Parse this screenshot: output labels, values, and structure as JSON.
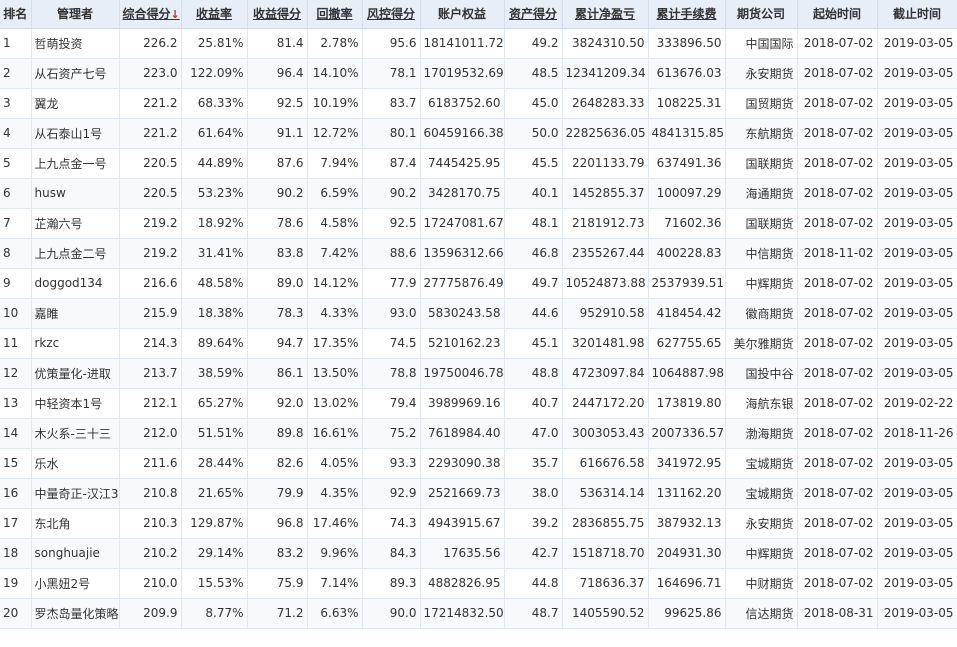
{
  "columns": [
    {
      "key": "rank",
      "label": "排名",
      "sortable": false,
      "align": "left"
    },
    {
      "key": "manager",
      "label": "管理者",
      "sortable": false,
      "align": "left"
    },
    {
      "key": "composite",
      "label": "综合得分",
      "sortable": true,
      "active": true,
      "arrow": "↓",
      "align": "right"
    },
    {
      "key": "return_rate",
      "label": "收益率",
      "sortable": true,
      "align": "right"
    },
    {
      "key": "return_score",
      "label": "收益得分",
      "sortable": true,
      "align": "right"
    },
    {
      "key": "drawdown",
      "label": "回撤率",
      "sortable": true,
      "align": "right"
    },
    {
      "key": "risk_score",
      "label": "风控得分",
      "sortable": true,
      "align": "right"
    },
    {
      "key": "equity",
      "label": "账户权益",
      "sortable": false,
      "align": "right"
    },
    {
      "key": "asset_score",
      "label": "资产得分",
      "sortable": true,
      "align": "right"
    },
    {
      "key": "net_pnl",
      "label": "累计净盈亏",
      "sortable": true,
      "align": "right"
    },
    {
      "key": "fees",
      "label": "累计手续费",
      "sortable": true,
      "align": "right"
    },
    {
      "key": "company",
      "label": "期货公司",
      "sortable": false,
      "align": "right"
    },
    {
      "key": "start",
      "label": "起始时间",
      "sortable": false,
      "align": "right"
    },
    {
      "key": "end",
      "label": "截止时间",
      "sortable": false,
      "align": "right"
    }
  ],
  "colors": {
    "link": "#1a4fd6",
    "profit": "#e02020",
    "header_bg": "#e6eef8"
  },
  "rows": [
    {
      "rank": "1",
      "manager": "哲萌投资",
      "composite": "226.2",
      "return_rate": "25.81%",
      "return_score": "81.4",
      "drawdown": "2.78%",
      "risk_score": "95.6",
      "equity": "18141011.72",
      "asset_score": "49.2",
      "net_pnl": "3824310.50",
      "fees": "333896.50",
      "company": "中国国际",
      "start": "2018-07-02",
      "end": "2019-03-05"
    },
    {
      "rank": "2",
      "manager": "从石资产七号",
      "composite": "223.0",
      "return_rate": "122.09%",
      "return_score": "96.4",
      "drawdown": "14.10%",
      "risk_score": "78.1",
      "equity": "17019532.69",
      "asset_score": "48.5",
      "net_pnl": "12341209.34",
      "fees": "613676.03",
      "company": "永安期货",
      "start": "2018-07-02",
      "end": "2019-03-05"
    },
    {
      "rank": "3",
      "manager": "翼龙",
      "composite": "221.2",
      "return_rate": "68.33%",
      "return_score": "92.5",
      "drawdown": "10.19%",
      "risk_score": "83.7",
      "equity": "6183752.60",
      "asset_score": "45.0",
      "net_pnl": "2648283.33",
      "fees": "108225.31",
      "company": "国贸期货",
      "start": "2018-07-02",
      "end": "2019-03-05"
    },
    {
      "rank": "4",
      "manager": "从石泰山1号",
      "composite": "221.2",
      "return_rate": "61.64%",
      "return_score": "91.1",
      "drawdown": "12.72%",
      "risk_score": "80.1",
      "equity": "60459166.38",
      "asset_score": "50.0",
      "net_pnl": "22825636.05",
      "fees": "4841315.85",
      "company": "东航期货",
      "start": "2018-07-02",
      "end": "2019-03-05"
    },
    {
      "rank": "5",
      "manager": "上九点金一号",
      "composite": "220.5",
      "return_rate": "44.89%",
      "return_score": "87.6",
      "drawdown": "7.94%",
      "risk_score": "87.4",
      "equity": "7445425.95",
      "asset_score": "45.5",
      "net_pnl": "2201133.79",
      "fees": "637491.36",
      "company": "国联期货",
      "start": "2018-07-02",
      "end": "2019-03-05"
    },
    {
      "rank": "6",
      "manager": "husw",
      "composite": "220.5",
      "return_rate": "53.23%",
      "return_score": "90.2",
      "drawdown": "6.59%",
      "risk_score": "90.2",
      "equity": "3428170.75",
      "asset_score": "40.1",
      "net_pnl": "1452855.37",
      "fees": "100097.29",
      "company": "海通期货",
      "start": "2018-07-02",
      "end": "2019-03-05"
    },
    {
      "rank": "7",
      "manager": "芷瀚六号",
      "composite": "219.2",
      "return_rate": "18.92%",
      "return_score": "78.6",
      "drawdown": "4.58%",
      "risk_score": "92.5",
      "equity": "17247081.67",
      "asset_score": "48.1",
      "net_pnl": "2181912.73",
      "fees": "71602.36",
      "company": "国联期货",
      "start": "2018-07-02",
      "end": "2019-03-05"
    },
    {
      "rank": "8",
      "manager": "上九点金二号",
      "composite": "219.2",
      "return_rate": "31.41%",
      "return_score": "83.8",
      "drawdown": "7.42%",
      "risk_score": "88.6",
      "equity": "13596312.66",
      "asset_score": "46.8",
      "net_pnl": "2355267.44",
      "fees": "400228.83",
      "company": "中信期货",
      "start": "2018-11-02",
      "end": "2019-03-05"
    },
    {
      "rank": "9",
      "manager": "doggod134",
      "composite": "216.6",
      "return_rate": "48.58%",
      "return_score": "89.0",
      "drawdown": "14.12%",
      "risk_score": "77.9",
      "equity": "27775876.49",
      "asset_score": "49.7",
      "net_pnl": "10524873.88",
      "fees": "2537939.51",
      "company": "中辉期货",
      "start": "2018-07-02",
      "end": "2019-03-05"
    },
    {
      "rank": "10",
      "manager": "嘉睢",
      "composite": "215.9",
      "return_rate": "18.38%",
      "return_score": "78.3",
      "drawdown": "4.33%",
      "risk_score": "93.0",
      "equity": "5830243.58",
      "asset_score": "44.6",
      "net_pnl": "952910.58",
      "fees": "418454.42",
      "company": "徽商期货",
      "start": "2018-07-02",
      "end": "2019-03-05"
    },
    {
      "rank": "11",
      "manager": "rkzc",
      "composite": "214.3",
      "return_rate": "89.64%",
      "return_score": "94.7",
      "drawdown": "17.35%",
      "risk_score": "74.5",
      "equity": "5210162.23",
      "asset_score": "45.1",
      "net_pnl": "3201481.98",
      "fees": "627755.65",
      "company": "美尔雅期货",
      "start": "2018-07-02",
      "end": "2019-03-05"
    },
    {
      "rank": "12",
      "manager": "优策量化-进取",
      "composite": "213.7",
      "return_rate": "38.59%",
      "return_score": "86.1",
      "drawdown": "13.50%",
      "risk_score": "78.8",
      "equity": "19750046.78",
      "asset_score": "48.8",
      "net_pnl": "4723097.84",
      "fees": "1064887.98",
      "company": "国投中谷",
      "start": "2018-07-02",
      "end": "2019-03-05"
    },
    {
      "rank": "13",
      "manager": "中轻资本1号",
      "composite": "212.1",
      "return_rate": "65.27%",
      "return_score": "92.0",
      "drawdown": "13.02%",
      "risk_score": "79.4",
      "equity": "3989969.16",
      "asset_score": "40.7",
      "net_pnl": "2447172.20",
      "fees": "173819.80",
      "company": "海航东银",
      "start": "2018-07-02",
      "end": "2019-02-22"
    },
    {
      "rank": "14",
      "manager": "木火系-三十三",
      "composite": "212.0",
      "return_rate": "51.51%",
      "return_score": "89.8",
      "drawdown": "16.61%",
      "risk_score": "75.2",
      "equity": "7618984.40",
      "asset_score": "47.0",
      "net_pnl": "3003053.43",
      "fees": "2007336.57",
      "company": "渤海期货",
      "start": "2018-07-02",
      "end": "2018-11-26"
    },
    {
      "rank": "15",
      "manager": "乐水",
      "composite": "211.6",
      "return_rate": "28.44%",
      "return_score": "82.6",
      "drawdown": "4.05%",
      "risk_score": "93.3",
      "equity": "2293090.38",
      "asset_score": "35.7",
      "net_pnl": "616676.58",
      "fees": "341972.95",
      "company": "宝城期货",
      "start": "2018-07-02",
      "end": "2019-03-05"
    },
    {
      "rank": "16",
      "manager": "中量奇正-汉江3",
      "composite": "210.8",
      "return_rate": "21.65%",
      "return_score": "79.9",
      "drawdown": "4.35%",
      "risk_score": "92.9",
      "equity": "2521669.73",
      "asset_score": "38.0",
      "net_pnl": "536314.14",
      "fees": "131162.20",
      "company": "宝城期货",
      "start": "2018-07-02",
      "end": "2019-03-05"
    },
    {
      "rank": "17",
      "manager": "东北角",
      "composite": "210.3",
      "return_rate": "129.87%",
      "return_score": "96.8",
      "drawdown": "17.46%",
      "risk_score": "74.3",
      "equity": "4943915.67",
      "asset_score": "39.2",
      "net_pnl": "2836855.75",
      "fees": "387932.13",
      "company": "永安期货",
      "start": "2018-07-02",
      "end": "2019-03-05"
    },
    {
      "rank": "18",
      "manager": "songhuajie",
      "composite": "210.2",
      "return_rate": "29.14%",
      "return_score": "83.2",
      "drawdown": "9.96%",
      "risk_score": "84.3",
      "equity": "17635.56",
      "asset_score": "42.7",
      "net_pnl": "1518718.70",
      "fees": "204931.30",
      "company": "中辉期货",
      "start": "2018-07-02",
      "end": "2019-03-05"
    },
    {
      "rank": "19",
      "manager": "小黑妞2号",
      "composite": "210.0",
      "return_rate": "15.53%",
      "return_score": "75.9",
      "drawdown": "7.14%",
      "risk_score": "89.3",
      "equity": "4882826.95",
      "asset_score": "44.8",
      "net_pnl": "718636.37",
      "fees": "164696.71",
      "company": "中财期货",
      "start": "2018-07-02",
      "end": "2019-03-05"
    },
    {
      "rank": "20",
      "manager": "罗杰岛量化策略",
      "composite": "209.9",
      "return_rate": "8.77%",
      "return_score": "71.2",
      "drawdown": "6.63%",
      "risk_score": "90.0",
      "equity": "17214832.50",
      "asset_score": "48.7",
      "net_pnl": "1405590.52",
      "fees": "99625.86",
      "company": "信达期货",
      "start": "2018-08-31",
      "end": "2019-03-05"
    }
  ]
}
